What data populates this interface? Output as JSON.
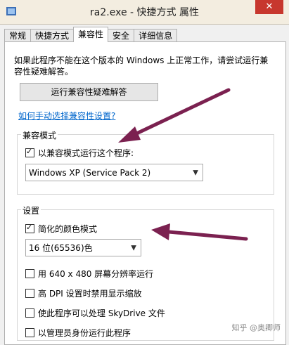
{
  "window": {
    "title": "ra2.exe - 快捷方式 属性",
    "close_glyph": "✕"
  },
  "tabs": [
    {
      "label": "常规"
    },
    {
      "label": "快捷方式"
    },
    {
      "label": "兼容性"
    },
    {
      "label": "安全"
    },
    {
      "label": "详细信息"
    }
  ],
  "compat": {
    "description": "如果此程序不能在这个版本的 Windows 上正常工作，请尝试运行兼容性疑难解答。",
    "troubleshoot_button": "运行兼容性疑难解答",
    "manual_link": "如何手动选择兼容性设置?",
    "compat_mode_group": "兼容模式",
    "run_compat_checkbox": "以兼容模式运行这个程序:",
    "run_compat_checked": true,
    "os_select_value": "Windows XP (Service Pack 2)",
    "settings_group": "设置",
    "reduced_color_checkbox": "简化的颜色模式",
    "reduced_color_checked": true,
    "color_select_value": "16 位(65536)色",
    "resolution_checkbox": "用 640 x 480 屏幕分辨率运行",
    "dpi_checkbox": "高 DPI 设置时禁用显示缩放",
    "skydrive_checkbox": "使此程序可以处理 SkyDrive 文件",
    "admin_checkbox": "以管理员身份运行此程序"
  },
  "watermark": "知乎 @奥卿师",
  "colors": {
    "arrow": "#7b2150",
    "link": "#0066cc",
    "close": "#c7372e"
  },
  "icons": [
    "app-icon",
    "chevron-down-icon",
    "annotation-arrow"
  ]
}
